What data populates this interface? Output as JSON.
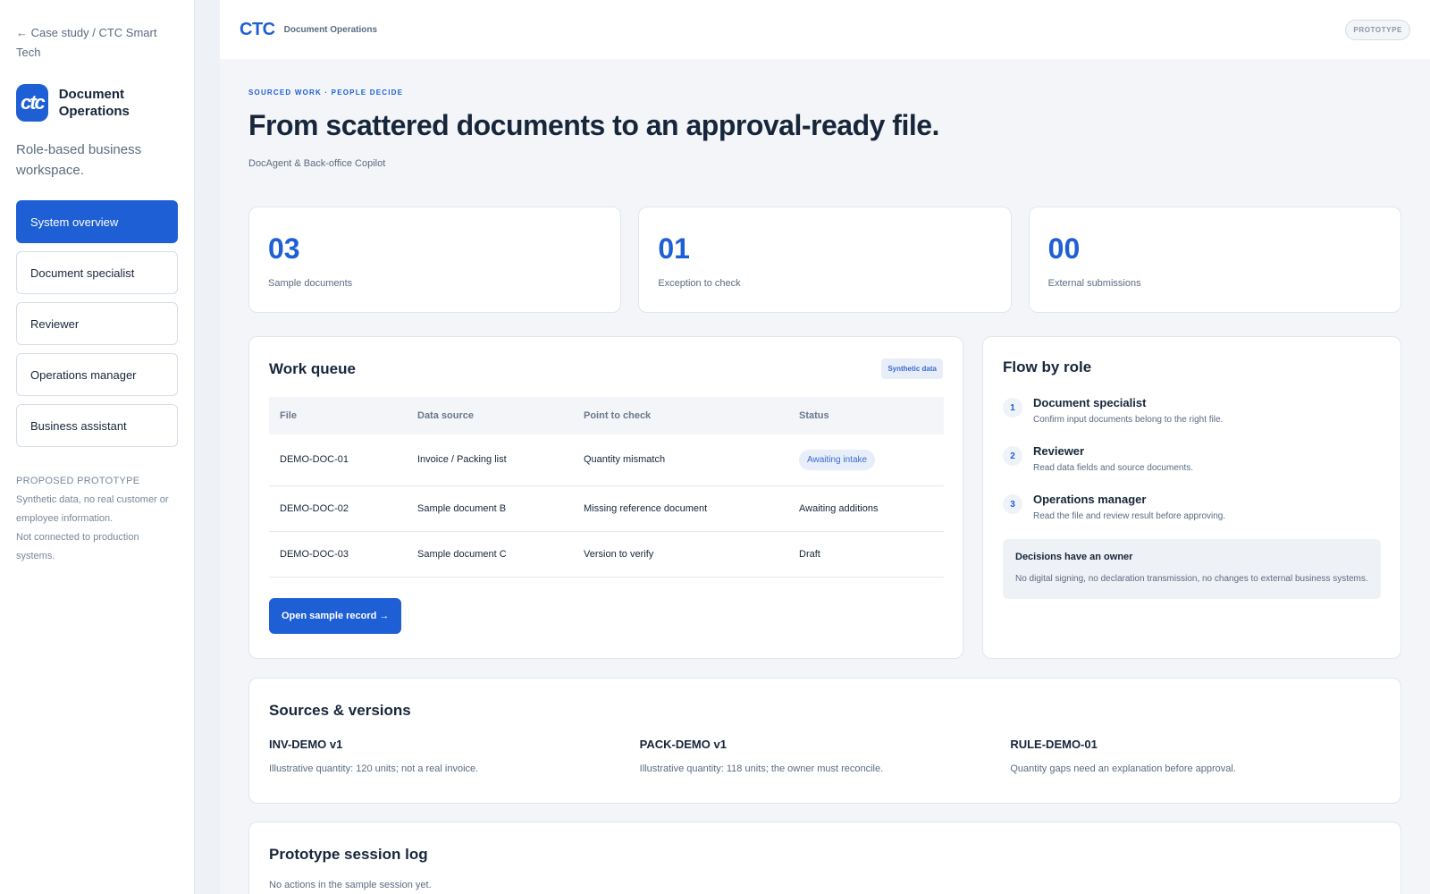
{
  "sidebar": {
    "back_link": "← Case study / CTC Smart Tech",
    "brand_logo": "ctc",
    "brand_name": "Document Operations",
    "brand_sub": "Role-based business workspace.",
    "nav": [
      {
        "label": "System overview",
        "active": true
      },
      {
        "label": "Document specialist"
      },
      {
        "label": "Reviewer"
      },
      {
        "label": "Operations manager"
      },
      {
        "label": "Business assistant"
      }
    ],
    "note_title": "PROPOSED PROTOTYPE",
    "note_line1": "Synthetic data, no real customer or employee information.",
    "note_line2": "Not connected to production systems."
  },
  "topbar": {
    "logo": "CTC",
    "title": "Document Operations",
    "badge": "PROTOTYPE"
  },
  "hero": {
    "eyebrow": "SOURCED WORK · PEOPLE DECIDE",
    "title": "From scattered documents to an approval-ready file.",
    "subtitle": "DocAgent & Back-office Copilot"
  },
  "stats": [
    {
      "value": "03",
      "label": "Sample documents"
    },
    {
      "value": "01",
      "label": "Exception to check"
    },
    {
      "value": "00",
      "label": "External submissions"
    }
  ],
  "queue": {
    "title": "Work queue",
    "badge": "Synthetic data",
    "columns": [
      "File",
      "Data source",
      "Point to check",
      "Status"
    ],
    "rows": [
      {
        "file": "DEMO-DOC-01",
        "source": "Invoice / Packing list",
        "point": "Quantity mismatch",
        "status": "Awaiting intake"
      },
      {
        "file": "DEMO-DOC-02",
        "source": "Sample document B",
        "point": "Missing reference document",
        "status": "Awaiting additions"
      },
      {
        "file": "DEMO-DOC-03",
        "source": "Sample document C",
        "point": "Version to verify",
        "status": "Draft"
      }
    ],
    "button": "Open sample record →"
  },
  "flow": {
    "title": "Flow by role",
    "steps": [
      {
        "num": "1",
        "title": "Document specialist",
        "desc": "Confirm input documents belong to the right file."
      },
      {
        "num": "2",
        "title": "Reviewer",
        "desc": "Read data fields and source documents."
      },
      {
        "num": "3",
        "title": "Operations manager",
        "desc": "Read the file and review result before approving."
      }
    ],
    "decision_title": "Decisions have an owner",
    "decision_text": "No digital signing, no declaration transmission, no changes to external business systems."
  },
  "sources": {
    "title": "Sources & versions",
    "items": [
      {
        "title": "INV-DEMO v1",
        "desc": "Illustrative quantity: 120 units; not a real invoice."
      },
      {
        "title": "PACK-DEMO v1",
        "desc": "Illustrative quantity: 118 units; the owner must reconcile."
      },
      {
        "title": "RULE-DEMO-01",
        "desc": "Quantity gaps need an explanation before approval."
      }
    ]
  },
  "session": {
    "title": "Prototype session log",
    "desc": "No actions in the sample session yet."
  }
}
